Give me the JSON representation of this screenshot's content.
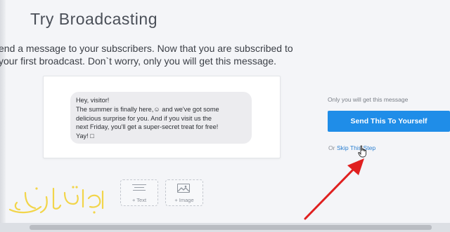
{
  "header": {
    "title": "Try Broadcasting"
  },
  "intro": {
    "line1": "end a message to your subscribers. Now that you are subscribed to",
    "line2": "your first broadcast. Don`t worry, only you will get this message."
  },
  "preview": {
    "message_lines": [
      "Hey, visitor!",
      "The summer is finally here,☺ and we've got some",
      "delicious surprise for you. And if you visit us the",
      "next Friday, you'll get a super-secret treat for free!",
      "Yay! □"
    ]
  },
  "add_blocks": {
    "text_label": "+ Text",
    "image_label": "+ Image"
  },
  "actions": {
    "note": "Only you will get this message",
    "send_label": "Send This To Yourself",
    "skip_prefix": "Or ",
    "skip_label": "Skip This Step"
  },
  "watermark": {
    "text": "المبدع تك"
  },
  "colors": {
    "accent": "#1f8de8",
    "link": "#2b7fd0",
    "annotation_arrow": "#e02020",
    "watermark": "#f2d54a"
  },
  "icons": [
    "text-block-icon",
    "image-block-icon",
    "hand-cursor-icon",
    "annotation-arrow-icon"
  ]
}
